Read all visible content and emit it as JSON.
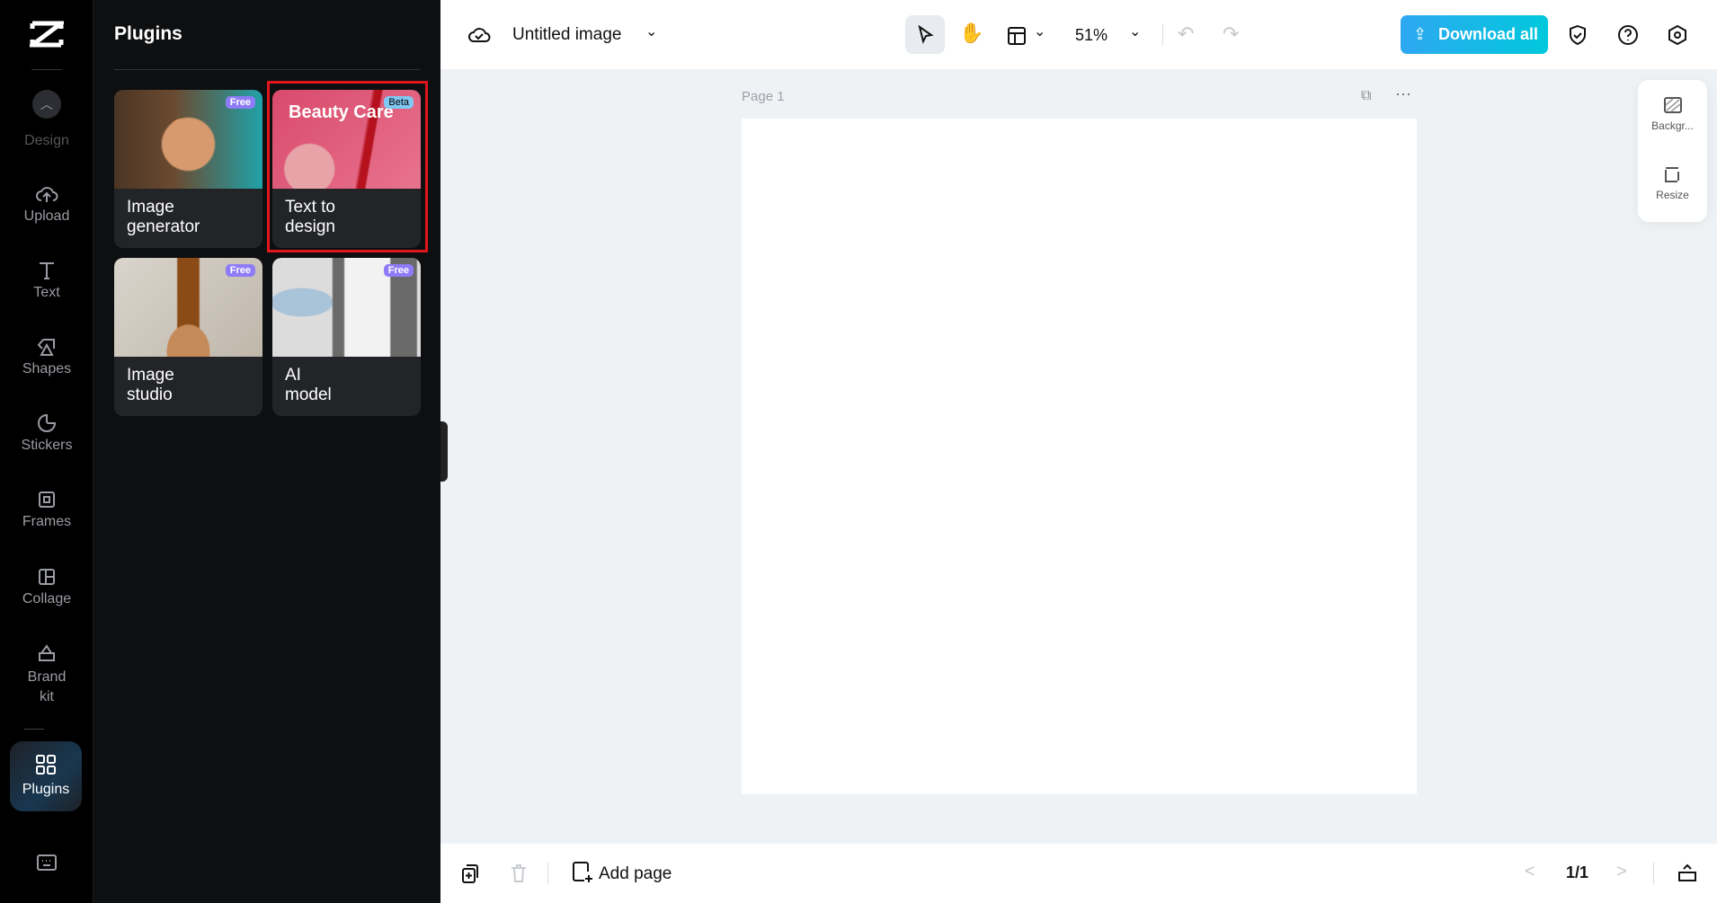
{
  "rail": {
    "items": [
      {
        "label": "Design"
      },
      {
        "label": "Upload"
      },
      {
        "label": "Text"
      },
      {
        "label": "Shapes"
      },
      {
        "label": "Stickers"
      },
      {
        "label": "Frames"
      },
      {
        "label": "Collage"
      },
      {
        "label": "Brand kit"
      },
      {
        "label": "Plugins"
      }
    ]
  },
  "panel": {
    "title": "Plugins",
    "cards": [
      {
        "label": "Image generator",
        "badge": "Free"
      },
      {
        "label": "Text to design",
        "badge": "Beta",
        "image_text": "Beauty Care"
      },
      {
        "label": "Image studio",
        "badge": "Free"
      },
      {
        "label": "AI model",
        "badge": "Free"
      }
    ]
  },
  "topbar": {
    "title": "Untitled image",
    "zoom": "51%",
    "download": "Download all"
  },
  "canvas": {
    "page_label": "Page 1"
  },
  "right_panel": {
    "background": "Backgr...",
    "resize": "Resize"
  },
  "bottombar": {
    "add_page": "Add page",
    "page_count": "1/1"
  },
  "colors": {
    "accent_start": "#2ea8f2",
    "accent_end": "#00c8dc",
    "highlight": "#e0161e",
    "badge": "#8e7cf7"
  }
}
